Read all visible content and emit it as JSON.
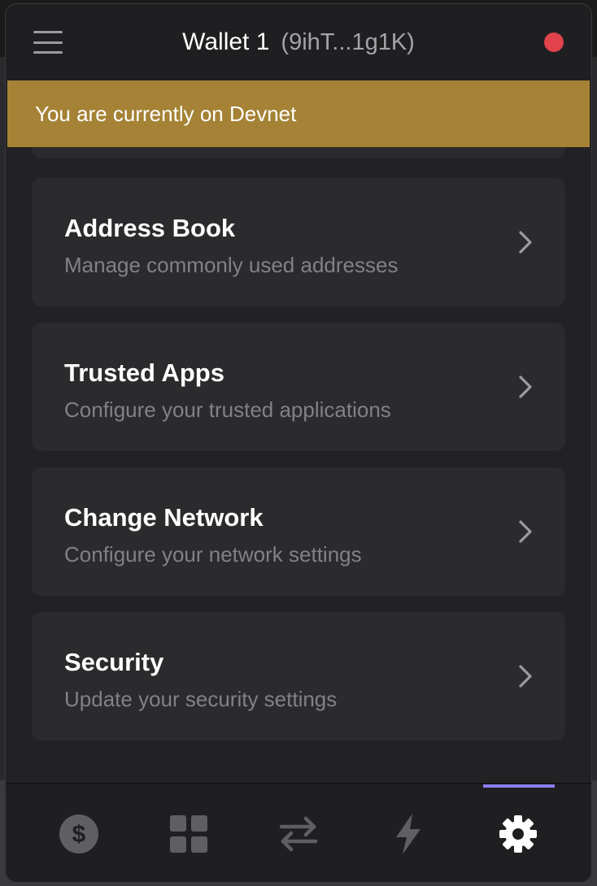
{
  "header": {
    "wallet_name": "Wallet 1",
    "wallet_address": "(9ihT...1g1K)",
    "status_color": "#e0434b"
  },
  "banner": {
    "text": "You are currently on Devnet",
    "color": "#a58235"
  },
  "settings": {
    "items": [
      {
        "title": "Address Book",
        "description": "Manage commonly used addresses"
      },
      {
        "title": "Trusted Apps",
        "description": "Configure your trusted applications"
      },
      {
        "title": "Change Network",
        "description": "Configure your network settings"
      },
      {
        "title": "Security",
        "description": "Update your security settings"
      }
    ]
  },
  "tabbar": {
    "tabs": [
      {
        "icon": "dollar-icon",
        "active": false
      },
      {
        "icon": "grid-icon",
        "active": false
      },
      {
        "icon": "swap-icon",
        "active": false
      },
      {
        "icon": "lightning-icon",
        "active": false
      },
      {
        "icon": "gear-icon",
        "active": true
      }
    ],
    "accent_color": "#8b7ef0"
  }
}
